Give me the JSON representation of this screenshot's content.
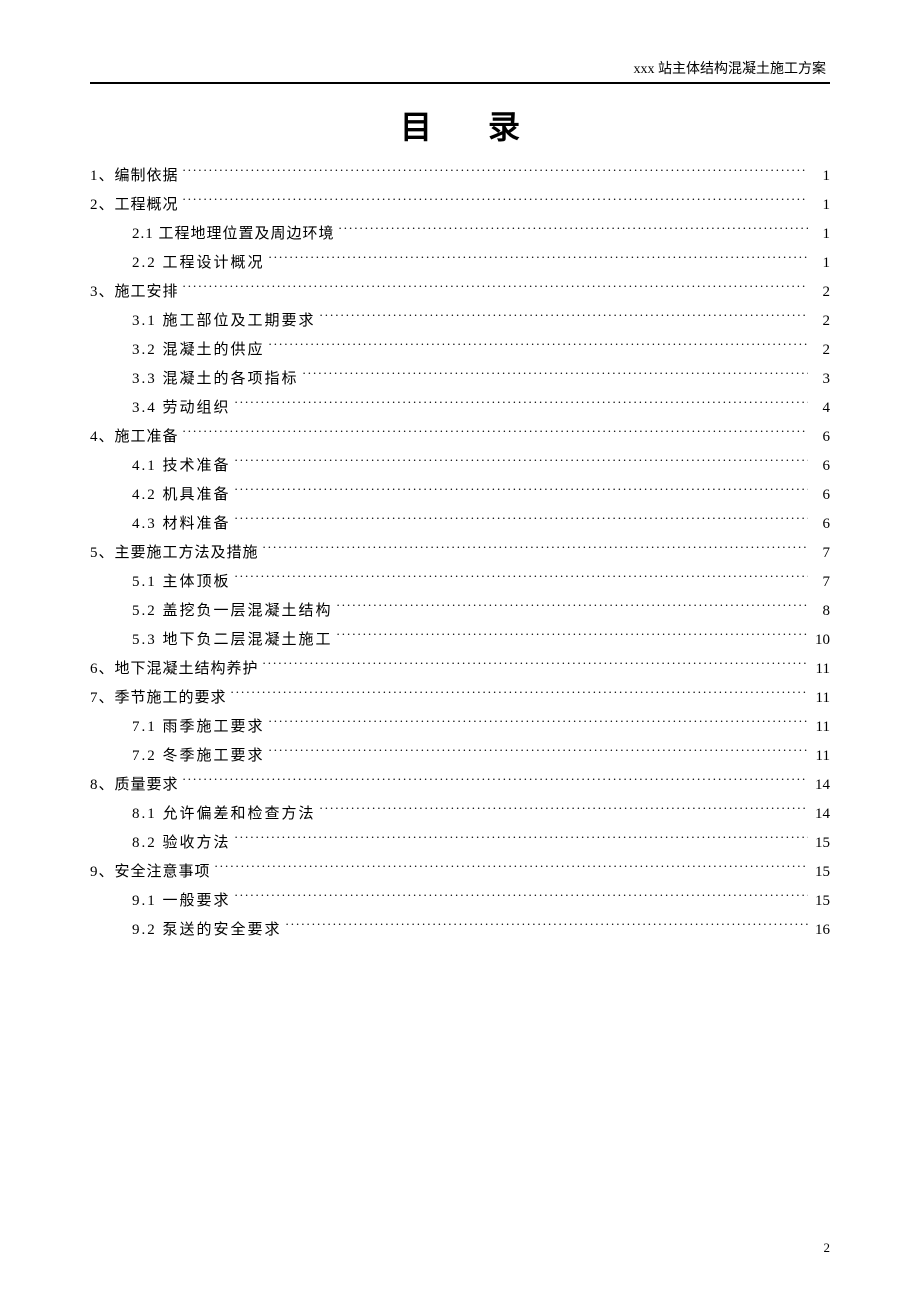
{
  "header": "xxx 站主体结构混凝土施工方案",
  "title": "目 录",
  "page_number": "2",
  "toc": [
    {
      "level": 1,
      "label": "1、编制依据",
      "page": "1"
    },
    {
      "level": 1,
      "label": "2、工程概况",
      "page": "1"
    },
    {
      "level": 2,
      "label": "2.1 工程地理位置及周边环境",
      "page": "1"
    },
    {
      "level": 2,
      "label": "2.2 工程设计概况",
      "page": "1",
      "spaced": true
    },
    {
      "level": 1,
      "label": "3、施工安排",
      "page": "2"
    },
    {
      "level": 2,
      "label": "3.1 施工部位及工期要求",
      "page": "2",
      "spaced": true
    },
    {
      "level": 2,
      "label": "3.2 混凝土的供应",
      "page": "2",
      "spaced": true
    },
    {
      "level": 2,
      "label": "3.3 混凝土的各项指标",
      "page": "3",
      "spaced": true
    },
    {
      "level": 2,
      "label": "3.4 劳动组织",
      "page": "4",
      "spaced": true
    },
    {
      "level": 1,
      "label": "4、施工准备",
      "page": "6"
    },
    {
      "level": 2,
      "label": "4.1 技术准备",
      "page": "6",
      "spaced": true
    },
    {
      "level": 2,
      "label": "4.2 机具准备",
      "page": "6",
      "spaced": true
    },
    {
      "level": 2,
      "label": "4.3 材料准备",
      "page": "6",
      "spaced": true
    },
    {
      "level": 1,
      "label": "5、主要施工方法及措施",
      "page": "7"
    },
    {
      "level": 2,
      "label": "5.1 主体顶板",
      "page": "7",
      "spaced": true
    },
    {
      "level": 2,
      "label": "5.2 盖挖负一层混凝土结构",
      "page": "8",
      "spaced": true
    },
    {
      "level": 2,
      "label": "5.3 地下负二层混凝土施工",
      "page": "10",
      "spaced": true
    },
    {
      "level": 1,
      "label": "6、地下混凝土结构养护",
      "page": "11"
    },
    {
      "level": 1,
      "label": "7、季节施工的要求",
      "page": "11"
    },
    {
      "level": 2,
      "label": "7.1 雨季施工要求",
      "page": "11",
      "spaced": true
    },
    {
      "level": 2,
      "label": "7.2 冬季施工要求",
      "page": "11",
      "spaced": true
    },
    {
      "level": 1,
      "label": "8、质量要求",
      "page": "14"
    },
    {
      "level": 2,
      "label": "8.1 允许偏差和检查方法",
      "page": "14",
      "spaced": true
    },
    {
      "level": 2,
      "label": "8.2 验收方法",
      "page": "15",
      "spaced": true
    },
    {
      "level": 1,
      "label": "9、安全注意事项",
      "page": "15"
    },
    {
      "level": 2,
      "label": "9.1 一般要求",
      "page": "15",
      "spaced": true
    },
    {
      "level": 2,
      "label": "9.2 泵送的安全要求",
      "page": "16",
      "spaced": true
    }
  ]
}
